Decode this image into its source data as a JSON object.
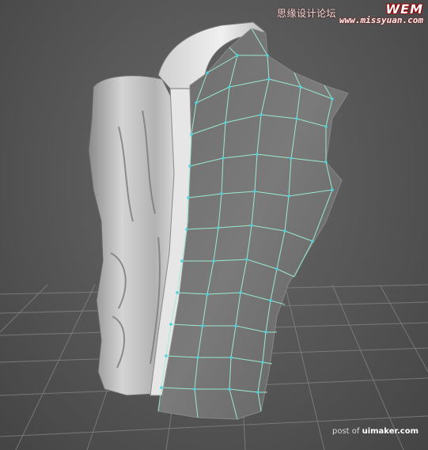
{
  "watermarks": {
    "top_cn": "思缘设计论坛",
    "top_brand": "WEM",
    "top_domain": "www.missyuan.com",
    "bottom_prefix": "post of",
    "bottom_site": "uimaker.com"
  },
  "colors": {
    "wire": "#9cf0d0",
    "vertex": "#4fd0e0",
    "sculpt_light": "#c8c8c8",
    "sculpt_dark": "#707070",
    "grid": "#8a8a8a"
  }
}
